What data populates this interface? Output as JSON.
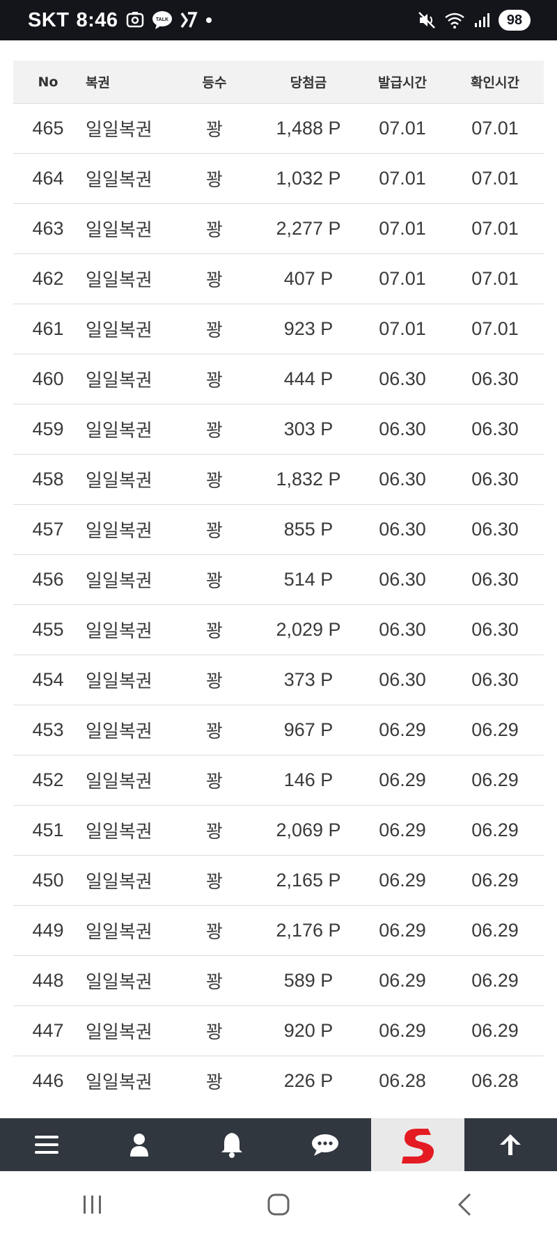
{
  "status_bar": {
    "carrier": "SKT",
    "time": "8:46",
    "talk_badge": "TALK",
    "battery": "98"
  },
  "table": {
    "headers": {
      "no": "No",
      "type": "복권",
      "rank": "등수",
      "amount": "당첨금",
      "issued": "발급시간",
      "checked": "확인시간"
    },
    "rows": [
      {
        "no": "465",
        "type": "일일복권",
        "rank": "꽝",
        "amount": "1,488 P",
        "issued": "07.01",
        "checked": "07.01"
      },
      {
        "no": "464",
        "type": "일일복권",
        "rank": "꽝",
        "amount": "1,032 P",
        "issued": "07.01",
        "checked": "07.01"
      },
      {
        "no": "463",
        "type": "일일복권",
        "rank": "꽝",
        "amount": "2,277 P",
        "issued": "07.01",
        "checked": "07.01"
      },
      {
        "no": "462",
        "type": "일일복권",
        "rank": "꽝",
        "amount": "407 P",
        "issued": "07.01",
        "checked": "07.01"
      },
      {
        "no": "461",
        "type": "일일복권",
        "rank": "꽝",
        "amount": "923 P",
        "issued": "07.01",
        "checked": "07.01"
      },
      {
        "no": "460",
        "type": "일일복권",
        "rank": "꽝",
        "amount": "444 P",
        "issued": "06.30",
        "checked": "06.30"
      },
      {
        "no": "459",
        "type": "일일복권",
        "rank": "꽝",
        "amount": "303 P",
        "issued": "06.30",
        "checked": "06.30"
      },
      {
        "no": "458",
        "type": "일일복권",
        "rank": "꽝",
        "amount": "1,832 P",
        "issued": "06.30",
        "checked": "06.30"
      },
      {
        "no": "457",
        "type": "일일복권",
        "rank": "꽝",
        "amount": "855 P",
        "issued": "06.30",
        "checked": "06.30"
      },
      {
        "no": "456",
        "type": "일일복권",
        "rank": "꽝",
        "amount": "514 P",
        "issued": "06.30",
        "checked": "06.30"
      },
      {
        "no": "455",
        "type": "일일복권",
        "rank": "꽝",
        "amount": "2,029 P",
        "issued": "06.30",
        "checked": "06.30"
      },
      {
        "no": "454",
        "type": "일일복권",
        "rank": "꽝",
        "amount": "373 P",
        "issued": "06.30",
        "checked": "06.30"
      },
      {
        "no": "453",
        "type": "일일복권",
        "rank": "꽝",
        "amount": "967 P",
        "issued": "06.29",
        "checked": "06.29"
      },
      {
        "no": "452",
        "type": "일일복권",
        "rank": "꽝",
        "amount": "146 P",
        "issued": "06.29",
        "checked": "06.29"
      },
      {
        "no": "451",
        "type": "일일복권",
        "rank": "꽝",
        "amount": "2,069 P",
        "issued": "06.29",
        "checked": "06.29"
      },
      {
        "no": "450",
        "type": "일일복권",
        "rank": "꽝",
        "amount": "2,165 P",
        "issued": "06.29",
        "checked": "06.29"
      },
      {
        "no": "449",
        "type": "일일복권",
        "rank": "꽝",
        "amount": "2,176 P",
        "issued": "06.29",
        "checked": "06.29"
      },
      {
        "no": "448",
        "type": "일일복권",
        "rank": "꽝",
        "amount": "589 P",
        "issued": "06.29",
        "checked": "06.29"
      },
      {
        "no": "447",
        "type": "일일복권",
        "rank": "꽝",
        "amount": "920 P",
        "issued": "06.29",
        "checked": "06.29"
      },
      {
        "no": "446",
        "type": "일일복권",
        "rank": "꽝",
        "amount": "226 P",
        "issued": "06.28",
        "checked": "06.28"
      }
    ]
  },
  "bottom_nav": {
    "items": [
      "menu-icon",
      "user-icon",
      "bell-icon",
      "chat-icon",
      "site-logo",
      "arrow-up-icon"
    ],
    "logo_color": "#e41b23",
    "background": "#31373f"
  },
  "system_nav": {
    "items": [
      "recent-apps-icon",
      "home-icon",
      "back-icon"
    ]
  }
}
